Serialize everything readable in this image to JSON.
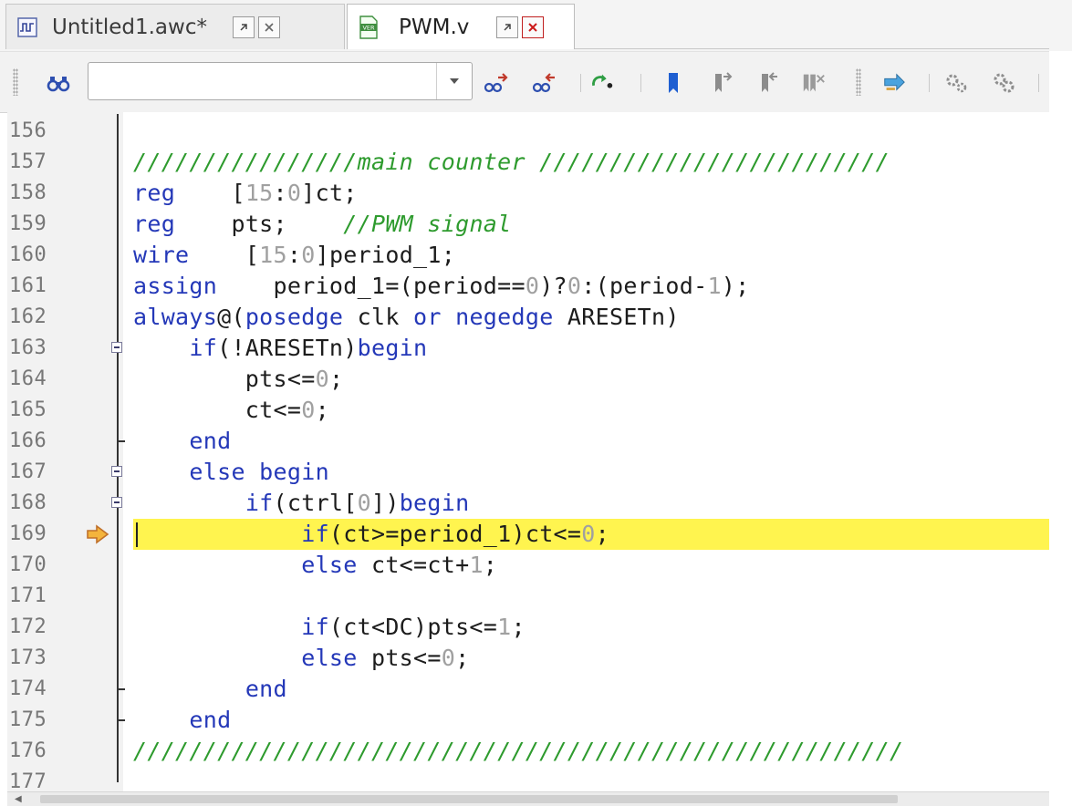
{
  "tabs": [
    {
      "label": "Untitled1.awc*",
      "icon": "waveform-icon",
      "active": false
    },
    {
      "label": "PWM.v",
      "icon": "verilog-file-icon",
      "active": true
    }
  ],
  "toolbar": {
    "search_value": "",
    "icons": [
      "binoculars-icon",
      "dropdown-arrow-icon",
      "find-next-icon",
      "find-previous-icon",
      "goto-execution-point-icon",
      "bookmark-icon",
      "next-bookmark-icon",
      "previous-bookmark-icon",
      "clear-bookmarks-icon",
      "step-into-icon",
      "settings-icon",
      "settings-2-icon"
    ]
  },
  "editor": {
    "highlight_color": "#fff44f",
    "lines": [
      {
        "n": "156",
        "segs": []
      },
      {
        "n": "157",
        "segs": [
          {
            "t": "////////////////main counter /////////////////////////",
            "c": "cm"
          }
        ]
      },
      {
        "n": "158",
        "segs": [
          {
            "t": "reg",
            "c": "kw"
          },
          {
            "t": "    ["
          },
          {
            "t": "15",
            "c": "nm"
          },
          {
            "t": ":"
          },
          {
            "t": "0",
            "c": "nm"
          },
          {
            "t": "]ct;"
          }
        ]
      },
      {
        "n": "159",
        "segs": [
          {
            "t": "reg",
            "c": "kw"
          },
          {
            "t": "    pts;    "
          },
          {
            "t": "//PWM signal",
            "c": "cm"
          }
        ]
      },
      {
        "n": "160",
        "segs": [
          {
            "t": "wire",
            "c": "kw"
          },
          {
            "t": "    ["
          },
          {
            "t": "15",
            "c": "nm"
          },
          {
            "t": ":"
          },
          {
            "t": "0",
            "c": "nm"
          },
          {
            "t": "]period_1;"
          }
        ]
      },
      {
        "n": "161",
        "segs": [
          {
            "t": "assign",
            "c": "kw"
          },
          {
            "t": "    period_1=(period=="
          },
          {
            "t": "0",
            "c": "nm"
          },
          {
            "t": ")?"
          },
          {
            "t": "0",
            "c": "nm"
          },
          {
            "t": ":(period-"
          },
          {
            "t": "1",
            "c": "nm"
          },
          {
            "t": ");"
          }
        ]
      },
      {
        "n": "162",
        "segs": [
          {
            "t": "always",
            "c": "kw"
          },
          {
            "t": "@("
          },
          {
            "t": "posedge",
            "c": "kw"
          },
          {
            "t": " clk "
          },
          {
            "t": "or",
            "c": "kw"
          },
          {
            "t": " "
          },
          {
            "t": "negedge",
            "c": "kw"
          },
          {
            "t": " ARESETn)"
          }
        ],
        "fold": "none"
      },
      {
        "n": "163",
        "segs": [
          {
            "t": "    "
          },
          {
            "t": "if",
            "c": "kw"
          },
          {
            "t": "(!ARESETn)"
          },
          {
            "t": "begin",
            "c": "kw"
          }
        ],
        "fold": "open"
      },
      {
        "n": "164",
        "segs": [
          {
            "t": "        pts<="
          },
          {
            "t": "0",
            "c": "nm"
          },
          {
            "t": ";"
          }
        ]
      },
      {
        "n": "165",
        "segs": [
          {
            "t": "        ct<="
          },
          {
            "t": "0",
            "c": "nm"
          },
          {
            "t": ";"
          }
        ]
      },
      {
        "n": "166",
        "segs": [
          {
            "t": "    "
          },
          {
            "t": "end",
            "c": "kw"
          }
        ],
        "fold": "end"
      },
      {
        "n": "167",
        "segs": [
          {
            "t": "    "
          },
          {
            "t": "else",
            "c": "kw"
          },
          {
            "t": " "
          },
          {
            "t": "begin",
            "c": "kw"
          }
        ],
        "fold": "open"
      },
      {
        "n": "168",
        "segs": [
          {
            "t": "        "
          },
          {
            "t": "if",
            "c": "kw"
          },
          {
            "t": "(ctrl["
          },
          {
            "t": "0",
            "c": "nm"
          },
          {
            "t": "])"
          },
          {
            "t": "begin",
            "c": "kw"
          }
        ],
        "fold": "open"
      },
      {
        "n": "169",
        "segs": [
          {
            "t": "            "
          },
          {
            "t": "if",
            "c": "kw"
          },
          {
            "t": "(ct>=period_1)ct<="
          },
          {
            "t": "0",
            "c": "nm"
          },
          {
            "t": ";"
          }
        ],
        "highlight": true,
        "breakpoint": true
      },
      {
        "n": "170",
        "segs": [
          {
            "t": "            "
          },
          {
            "t": "else",
            "c": "kw"
          },
          {
            "t": " ct<=ct+"
          },
          {
            "t": "1",
            "c": "nm"
          },
          {
            "t": ";"
          }
        ]
      },
      {
        "n": "171",
        "segs": []
      },
      {
        "n": "172",
        "segs": [
          {
            "t": "            "
          },
          {
            "t": "if",
            "c": "kw"
          },
          {
            "t": "(ct<DC)pts<="
          },
          {
            "t": "1",
            "c": "nm"
          },
          {
            "t": ";"
          }
        ]
      },
      {
        "n": "173",
        "segs": [
          {
            "t": "            "
          },
          {
            "t": "else",
            "c": "kw"
          },
          {
            "t": " pts<="
          },
          {
            "t": "0",
            "c": "nm"
          },
          {
            "t": ";"
          }
        ]
      },
      {
        "n": "174",
        "segs": [
          {
            "t": "        "
          },
          {
            "t": "end",
            "c": "kw"
          }
        ],
        "fold": "end"
      },
      {
        "n": "175",
        "segs": [
          {
            "t": "    "
          },
          {
            "t": "end",
            "c": "kw"
          }
        ],
        "fold": "end"
      },
      {
        "n": "176",
        "segs": [
          {
            "t": "///////////////////////////////////////////////////////",
            "c": "cm"
          }
        ]
      },
      {
        "n": "177",
        "segs": []
      }
    ]
  }
}
